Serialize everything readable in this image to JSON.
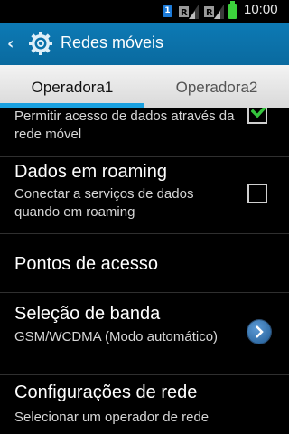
{
  "status_bar": {
    "sim_number": "1",
    "time": "10:00",
    "battery_color": "#3cd23c",
    "sim_color": "#1c7ad8"
  },
  "action_bar": {
    "title": "Redes móveis",
    "back_icon": "chevron-left-icon",
    "app_icon": "gear-icon",
    "bar_color": "#0b72aa"
  },
  "tabs": [
    {
      "label": "Operadora1",
      "selected": true
    },
    {
      "label": "Operadora2",
      "selected": false
    }
  ],
  "accent_color": "#1aa1e0",
  "items": [
    {
      "subtitle": "Permitir acesso de dados através da rede móvel",
      "control": "checkbox",
      "checked": true
    },
    {
      "title": "Dados em roaming",
      "subtitle": "Conectar a serviços de dados quando em roaming",
      "control": "checkbox",
      "checked": false
    },
    {
      "title": "Pontos de acesso"
    },
    {
      "title": "Seleção de banda",
      "subtitle": "GSM/WCDMA (Modo automático)",
      "control": "chevron-right-icon"
    },
    {
      "title": "Configurações de rede",
      "subtitle": "Selecionar um operador de rede"
    }
  ]
}
